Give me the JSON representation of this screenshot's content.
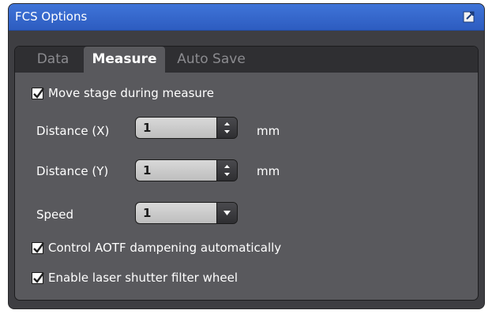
{
  "window": {
    "title": "FCS Options"
  },
  "tabs": [
    "Data",
    "Measure",
    "Auto Save"
  ],
  "measure": {
    "move_stage_label": "Move stage during measure",
    "distance_x": {
      "label": "Distance (X)",
      "value": "1",
      "unit": "mm"
    },
    "distance_y": {
      "label": "Distance (Y)",
      "value": "1",
      "unit": "mm"
    },
    "speed": {
      "label": "Speed",
      "value": "1"
    },
    "aotf_label": "Control AOTF dampening automatically",
    "laser_shutter_label": "Enable laser shutter filter wheel"
  },
  "icons": {
    "undock": "undock-icon",
    "check": "checkmark-icon",
    "spin": "spinner-arrows-icon",
    "dropdown": "chevron-down-icon"
  }
}
